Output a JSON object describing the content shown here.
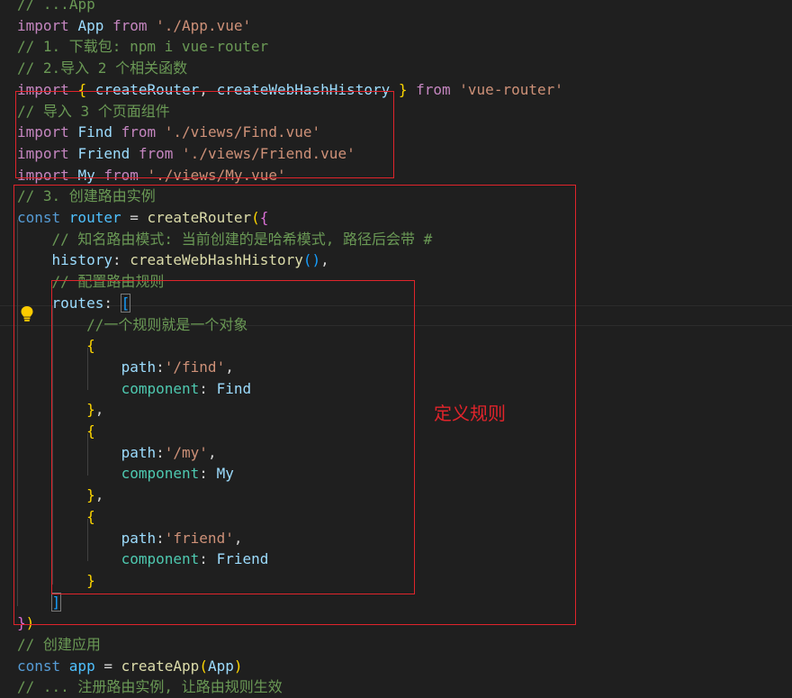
{
  "colors": {
    "background": "#1f1f1f",
    "annotation_red": "#e0242b",
    "keyword": "#c586c0",
    "storage": "#569cd6",
    "string": "#ce9178",
    "comment": "#6a9955"
  },
  "editor": {
    "lines": [
      [
        {
          "t": "// ",
          "c": "comment"
        },
        {
          "t": "...",
          "c": "comment"
        },
        {
          "t": "App",
          "c": "comment"
        }
      ],
      [
        {
          "t": "import ",
          "c": "keyword"
        },
        {
          "t": "App ",
          "c": "var"
        },
        {
          "t": "from ",
          "c": "keyword"
        },
        {
          "t": "'./App.vue'",
          "c": "string"
        }
      ],
      [
        {
          "t": "// 1. 下载包: npm i vue-router",
          "c": "comment"
        }
      ],
      [
        {
          "t": "// 2.导入 2 个相关函数",
          "c": "comment"
        }
      ],
      [
        {
          "t": "import ",
          "c": "keyword"
        },
        {
          "t": "{ ",
          "c": "br1"
        },
        {
          "t": "createRouter",
          "c": "var"
        },
        {
          "t": ", ",
          "c": "plain"
        },
        {
          "t": "createWebHashHistory",
          "c": "var"
        },
        {
          "t": " }",
          "c": "br1"
        },
        {
          "t": " from ",
          "c": "keyword"
        },
        {
          "t": "'vue-router'",
          "c": "string"
        }
      ],
      [
        {
          "t": "// 导入 3 个页面组件",
          "c": "comment"
        }
      ],
      [
        {
          "t": "import ",
          "c": "keyword"
        },
        {
          "t": "Find ",
          "c": "var"
        },
        {
          "t": "from ",
          "c": "keyword"
        },
        {
          "t": "'./views/Find.vue'",
          "c": "string"
        }
      ],
      [
        {
          "t": "import ",
          "c": "keyword"
        },
        {
          "t": "Friend ",
          "c": "var"
        },
        {
          "t": "from ",
          "c": "keyword"
        },
        {
          "t": "'./views/Friend.vue'",
          "c": "string"
        }
      ],
      [
        {
          "t": "import ",
          "c": "keyword"
        },
        {
          "t": "My ",
          "c": "var"
        },
        {
          "t": "from ",
          "c": "keyword"
        },
        {
          "t": "'./views/My.vue'",
          "c": "string"
        }
      ],
      [
        {
          "t": "// 3. 创建路由实例",
          "c": "comment"
        }
      ],
      [
        {
          "t": "const ",
          "c": "storage"
        },
        {
          "t": "router",
          "c": "const"
        },
        {
          "t": " = ",
          "c": "plain"
        },
        {
          "t": "createRouter",
          "c": "func"
        },
        {
          "t": "(",
          "c": "br1"
        },
        {
          "t": "{",
          "c": "br2"
        }
      ],
      [
        {
          "t": "    // 知名路由模式: 当前创建的是哈希模式, 路径后会带 #",
          "c": "comment"
        }
      ],
      [
        {
          "t": "    ",
          "c": "plain"
        },
        {
          "t": "history",
          "c": "prop"
        },
        {
          "t": ": ",
          "c": "plain"
        },
        {
          "t": "createWebHashHistory",
          "c": "func"
        },
        {
          "t": "()",
          "c": "br3"
        },
        {
          "t": ",",
          "c": "plain"
        }
      ],
      [
        {
          "t": "    // 配置路由规则",
          "c": "comment"
        }
      ],
      [
        {
          "t": "    ",
          "c": "plain"
        },
        {
          "t": "routes",
          "c": "prop"
        },
        {
          "t": ": ",
          "c": "plain"
        },
        {
          "t": "[",
          "c": "br3",
          "box": true
        }
      ],
      [
        {
          "t": "        //一个规则就是一个对象",
          "c": "comment"
        }
      ],
      [
        {
          "t": "        ",
          "c": "plain"
        },
        {
          "t": "{",
          "c": "br1"
        }
      ],
      [
        {
          "t": "            ",
          "c": "plain"
        },
        {
          "t": "path",
          "c": "prop"
        },
        {
          "t": ":",
          "c": "plain"
        },
        {
          "t": "'/find'",
          "c": "string"
        },
        {
          "t": ",",
          "c": "plain"
        }
      ],
      [
        {
          "t": "            ",
          "c": "plain"
        },
        {
          "t": "component",
          "c": "comp"
        },
        {
          "t": ": ",
          "c": "plain"
        },
        {
          "t": "Find",
          "c": "var"
        }
      ],
      [
        {
          "t": "        ",
          "c": "plain"
        },
        {
          "t": "}",
          "c": "br1"
        },
        {
          "t": ",",
          "c": "plain"
        }
      ],
      [
        {
          "t": "        ",
          "c": "plain"
        },
        {
          "t": "{",
          "c": "br1"
        }
      ],
      [
        {
          "t": "            ",
          "c": "plain"
        },
        {
          "t": "path",
          "c": "prop"
        },
        {
          "t": ":",
          "c": "plain"
        },
        {
          "t": "'/my'",
          "c": "string"
        },
        {
          "t": ",",
          "c": "plain"
        }
      ],
      [
        {
          "t": "            ",
          "c": "plain"
        },
        {
          "t": "component",
          "c": "comp"
        },
        {
          "t": ": ",
          "c": "plain"
        },
        {
          "t": "My",
          "c": "var"
        }
      ],
      [
        {
          "t": "        ",
          "c": "plain"
        },
        {
          "t": "}",
          "c": "br1"
        },
        {
          "t": ",",
          "c": "plain"
        }
      ],
      [
        {
          "t": "        ",
          "c": "plain"
        },
        {
          "t": "{",
          "c": "br1"
        }
      ],
      [
        {
          "t": "            ",
          "c": "plain"
        },
        {
          "t": "path",
          "c": "prop"
        },
        {
          "t": ":",
          "c": "plain"
        },
        {
          "t": "'friend'",
          "c": "string"
        },
        {
          "t": ",",
          "c": "plain"
        }
      ],
      [
        {
          "t": "            ",
          "c": "plain"
        },
        {
          "t": "component",
          "c": "comp"
        },
        {
          "t": ": ",
          "c": "plain"
        },
        {
          "t": "Friend",
          "c": "var"
        }
      ],
      [
        {
          "t": "        ",
          "c": "plain"
        },
        {
          "t": "}",
          "c": "br1"
        }
      ],
      [
        {
          "t": "    ",
          "c": "plain"
        },
        {
          "t": "]",
          "c": "br3",
          "box": true
        }
      ],
      [
        {
          "t": "}",
          "c": "br2"
        },
        {
          "t": ")",
          "c": "br1"
        }
      ],
      [
        {
          "t": "// 创建应用",
          "c": "comment"
        }
      ],
      [
        {
          "t": "const ",
          "c": "storage"
        },
        {
          "t": "app",
          "c": "const"
        },
        {
          "t": " = ",
          "c": "plain"
        },
        {
          "t": "createApp",
          "c": "func"
        },
        {
          "t": "(",
          "c": "br1"
        },
        {
          "t": "App",
          "c": "var"
        },
        {
          "t": ")",
          "c": "br1"
        }
      ],
      [
        {
          "t": "// ... 注册路由实例, 让路由规则生效",
          "c": "comment"
        }
      ]
    ]
  },
  "annotation": {
    "label": "定义规则"
  },
  "lightbulb_icon": "lightbulb-icon"
}
